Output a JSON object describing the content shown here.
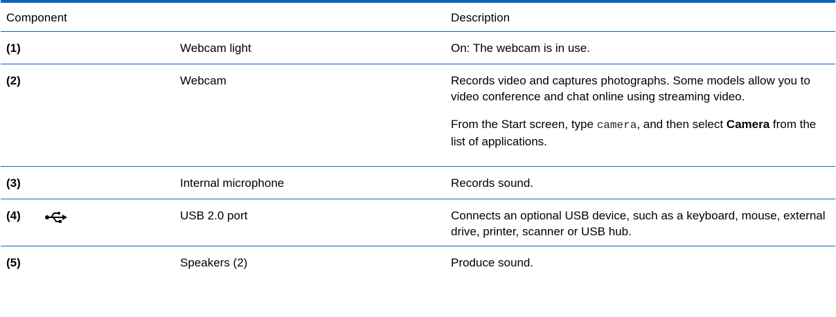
{
  "header": {
    "component": "Component",
    "description": "Description"
  },
  "rows": [
    {
      "num": "(1)",
      "name": "Webcam light",
      "desc": [
        "On: The webcam is in use."
      ]
    },
    {
      "num": "(2)",
      "name": "Webcam",
      "desc": [
        "Records video and captures photographs. Some models allow you to video conference and chat online using streaming video."
      ],
      "desc2": {
        "a": "From the Start screen, type ",
        "code": "camera",
        "b": ", and then select ",
        "bold": "Camera",
        "c": " from the list of applications."
      }
    },
    {
      "num": "(3)",
      "name": "Internal microphone",
      "desc": [
        "Records sound."
      ]
    },
    {
      "num": "(4)",
      "icon": "usb-icon",
      "name": "USB 2.0 port",
      "desc": [
        "Connects an optional USB device, such as a keyboard, mouse, external drive, printer, scanner or USB hub."
      ]
    },
    {
      "num": "(5)",
      "name": "Speakers (2)",
      "desc": [
        "Produce sound."
      ]
    }
  ],
  "colors": {
    "rule": "#0a63c9"
  }
}
